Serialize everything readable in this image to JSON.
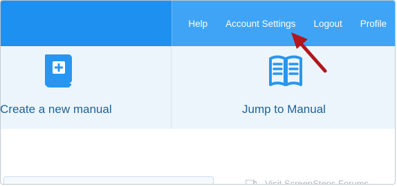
{
  "nav": {
    "links": [
      {
        "label": "Help"
      },
      {
        "label": "Account Settings"
      },
      {
        "label": "Logout"
      },
      {
        "label": "Profile"
      }
    ]
  },
  "tiles": {
    "create": {
      "label": "Create a new manual",
      "icon": "book-plus-icon"
    },
    "jump": {
      "label": "Jump to Manual",
      "icon": "open-book-icon"
    }
  },
  "sidebar": {
    "forum_link": "Visit ScreenSteps Forums",
    "forum_icon": "forum-icon"
  },
  "colors": {
    "nav_left": "#1e90f0",
    "nav_right": "#3fa4f5",
    "tile_bg": "#ecf5fc",
    "tile_text": "#1f6296",
    "icon": "#2896f0",
    "arrow": "#b3161e"
  }
}
